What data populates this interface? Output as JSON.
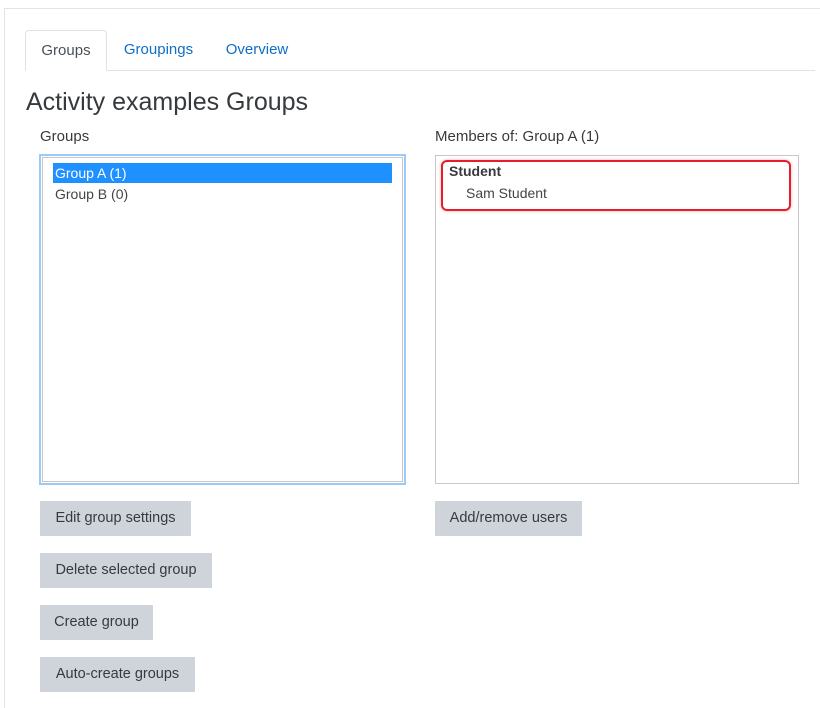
{
  "tabs": [
    {
      "label": "Groups",
      "active": true
    },
    {
      "label": "Groupings",
      "active": false
    },
    {
      "label": "Overview",
      "active": false
    }
  ],
  "page": {
    "title": "Activity examples Groups"
  },
  "groups_panel": {
    "label": "Groups",
    "options": [
      {
        "label": "Group A (1)",
        "selected": true
      },
      {
        "label": "Group B (0)",
        "selected": false
      }
    ]
  },
  "members_panel": {
    "label": "Members of: Group A (1)",
    "role": "Student",
    "members": [
      "Sam Student"
    ]
  },
  "buttons": {
    "edit_group_settings": "Edit group settings",
    "delete_selected_group": "Delete selected group",
    "create_group": "Create group",
    "auto_create_groups": "Auto-create groups",
    "add_remove_users": "Add/remove users"
  },
  "colors": {
    "link": "#0f6fc5",
    "selected_bg": "#1e90ff",
    "button_bg": "#ced4da",
    "highlight": "#e3202a"
  }
}
